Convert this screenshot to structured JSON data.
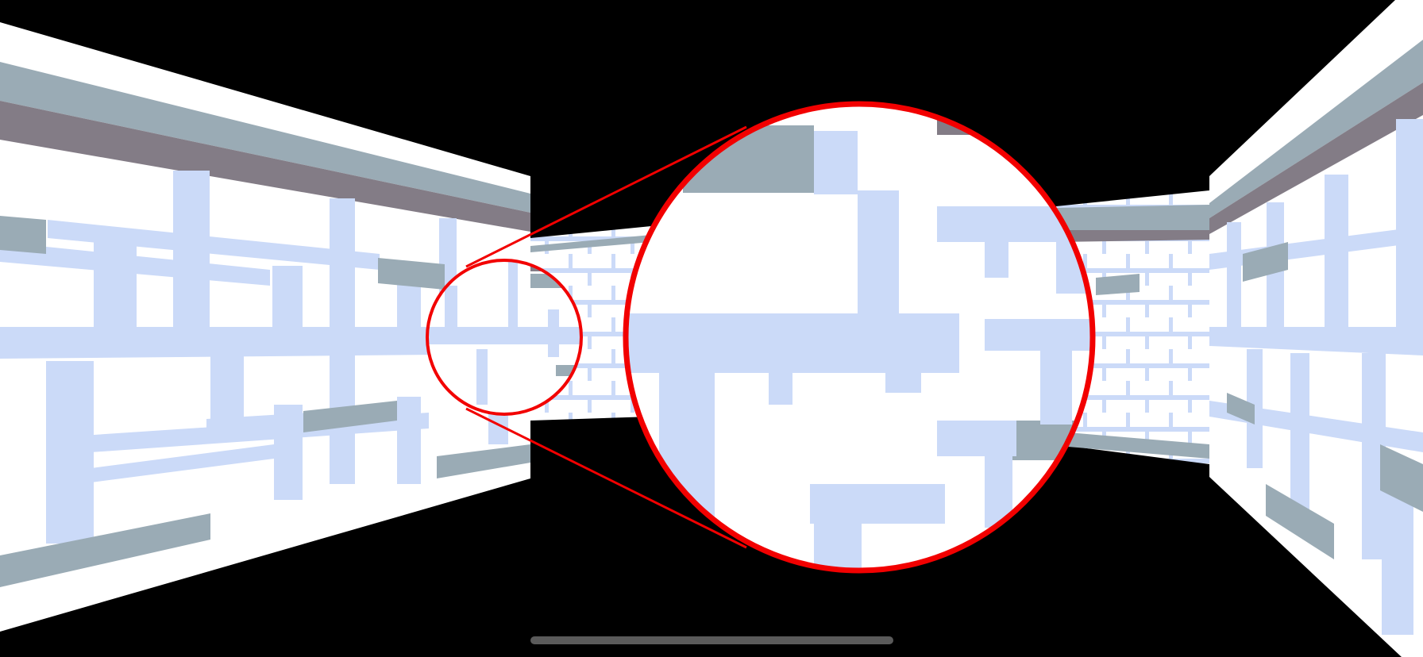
{
  "scene": {
    "kind": "first-person maze corridor",
    "background_color": "#000000",
    "wall_color": "#ffffff",
    "mortar_color": "#cbdaf8",
    "trim_light_color": "#9aabb5",
    "trim_dark_color": "#837c86"
  },
  "magnifier": {
    "outline_color": "#f20000"
  },
  "home_indicator": {
    "color": "#5a5a5a"
  }
}
